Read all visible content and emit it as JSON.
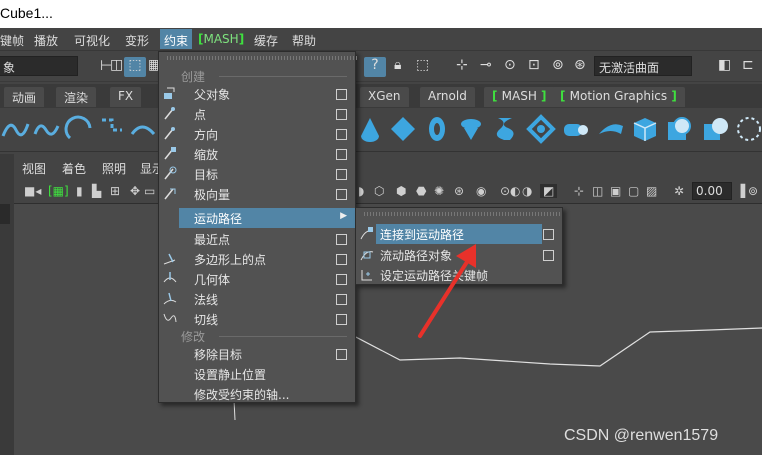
{
  "window": {
    "title": "Cube1..."
  },
  "menubar": {
    "items": [
      "键帧",
      "播放",
      "可视化",
      "变形",
      "约束",
      "MASH",
      "缓存",
      "帮助"
    ],
    "active": "约束"
  },
  "toolbar": {
    "object_field": "象",
    "curve_field": "无激活曲面"
  },
  "shelf_tabs": [
    "动画",
    "渲染",
    "FX",
    "XGen",
    "Arnold",
    "MASH",
    "Motion Graphics"
  ],
  "viewport": {
    "menu": [
      "视图",
      "着色",
      "照明",
      "显示"
    ],
    "value_field": "0.00"
  },
  "constrain_menu": {
    "section_create": "创建",
    "section_modify": "修改",
    "create_items": [
      {
        "label": "父对象",
        "icon": "parent-icon"
      },
      {
        "label": "点",
        "icon": "point-icon"
      },
      {
        "label": "方向",
        "icon": "orient-icon"
      },
      {
        "label": "缩放",
        "icon": "scale-icon"
      },
      {
        "label": "目标",
        "icon": "aim-icon"
      },
      {
        "label": "极向量",
        "icon": "pole-vector-icon"
      },
      {
        "label": "运动路径",
        "icon": "",
        "submenu": true
      },
      {
        "label": "最近点",
        "icon": ""
      },
      {
        "label": "多边形上的点",
        "icon": "point-on-poly-icon"
      },
      {
        "label": "几何体",
        "icon": "geometry-icon"
      },
      {
        "label": "法线",
        "icon": "normal-icon"
      },
      {
        "label": "切线",
        "icon": "tangent-icon"
      }
    ],
    "modify_items": [
      {
        "label": "移除目标"
      },
      {
        "label": "设置静止位置"
      },
      {
        "label": "修改受约束的轴..."
      }
    ]
  },
  "motion_path_submenu": {
    "items": [
      {
        "label": "连接到运动路径",
        "highlighted": true
      },
      {
        "label": "流动路径对象"
      },
      {
        "label": "设定运动路径关键帧"
      }
    ]
  },
  "watermark": "CSDN @renwen1579",
  "colors": {
    "highlight": "#5285a6",
    "menu_bg": "#525252",
    "mash_green": "#3fe03f",
    "annotation_red": "#e8312a"
  }
}
